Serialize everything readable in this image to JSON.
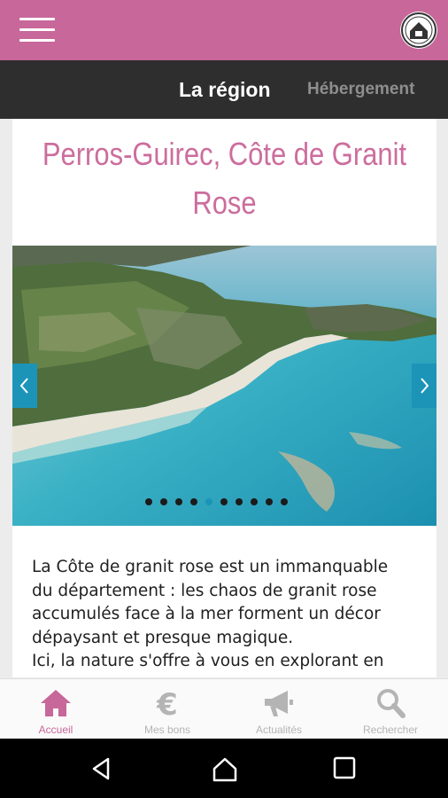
{
  "app": {
    "accent_color": "#c7679a",
    "menu_icon": "hamburger-menu-icon",
    "logo_icon": "brand-logo"
  },
  "tabs": [
    {
      "label": "La région",
      "active": true
    },
    {
      "label": "Hébergement",
      "active": false
    }
  ],
  "content": {
    "title_line1": "Perros-Guirec,  Côte de Granit",
    "title_line2": "Rose",
    "slider": {
      "image": "aerial-coast-photo",
      "dot_count": 10,
      "active_dot": 5,
      "prev_icon": "chevron-left-icon",
      "next_icon": "chevron-right-icon"
    },
    "description_lines": [
      "La Côte de granit rose est un immanquable",
      "du département : les chaos de granit rose",
      "accumulés face à la mer forment un décor",
      "dépaysant et presque magique.",
      "Ici, la nature s'offre à vous en explorant en"
    ]
  },
  "bottom_nav": [
    {
      "label": "Accueil",
      "icon": "home-icon",
      "active": true
    },
    {
      "label": "Mes bons",
      "icon": "euro-icon",
      "active": false
    },
    {
      "label": "Actualités",
      "icon": "megaphone-icon",
      "active": false
    },
    {
      "label": "Rechercher",
      "icon": "search-icon",
      "active": false
    }
  ],
  "system_nav": [
    "back-icon",
    "home-circle-icon",
    "recents-icon"
  ]
}
